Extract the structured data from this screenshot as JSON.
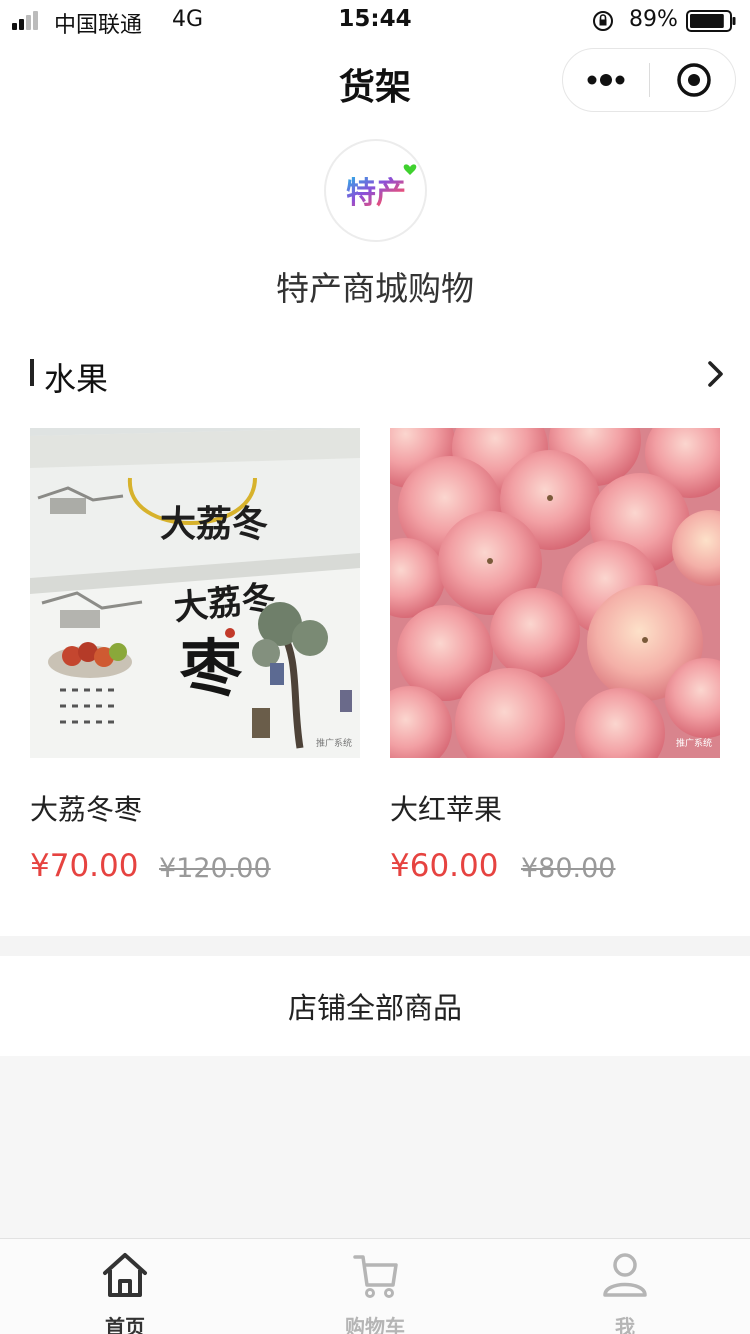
{
  "status_bar": {
    "carrier": "中国联通",
    "network": "4G",
    "time": "15:44",
    "battery_percent": "89%",
    "battery_level": 0.89
  },
  "nav": {
    "title": "货架",
    "more_icon": "more-dots-icon",
    "close_icon": "target-circle-icon"
  },
  "shop": {
    "logo_text": "特产",
    "name": "特产商城购物"
  },
  "section": {
    "title": "水果",
    "arrow_icon": "chevron-right-icon"
  },
  "products": [
    {
      "name": "大荔冬枣",
      "price": "¥70.00",
      "original_price": "¥120.00",
      "image_text_main": "大荔冬枣",
      "image_text_top": "大荔冬",
      "watermark": "推广系统"
    },
    {
      "name": "大红苹果",
      "price": "¥60.00",
      "original_price": "¥80.00",
      "watermark": "推广系统"
    }
  ],
  "all_goods_label": "店铺全部商品",
  "tabs": [
    {
      "label": "首页",
      "icon": "home-icon",
      "active": true
    },
    {
      "label": "购物车",
      "icon": "cart-icon",
      "active": false
    },
    {
      "label": "我",
      "icon": "user-icon",
      "active": false
    }
  ],
  "colors": {
    "price": "#e64340",
    "tab_active": "#333333",
    "tab_inactive": "#b5b5b5"
  }
}
